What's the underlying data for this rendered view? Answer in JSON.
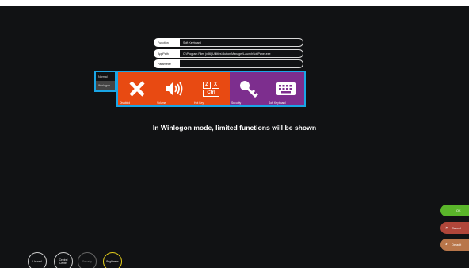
{
  "fields": [
    {
      "label": "Function",
      "value": "Soft Keyboard"
    },
    {
      "label": "AppPath",
      "value": "C:\\Program Files (x86)\\Utilities\\Button Manager\\LaunchSoftPanel.exe"
    },
    {
      "label": "Parameter",
      "value": ""
    }
  ],
  "modes": [
    {
      "label": "Normal"
    },
    {
      "label": "Winlogon"
    }
  ],
  "tiles": [
    {
      "caption": "Disabled",
      "icon": "close-icon",
      "color": "#e84a12"
    },
    {
      "caption": "Volume",
      "icon": "volume-icon",
      "color": "#e84a12"
    },
    {
      "caption": "Hot Key",
      "icon": "hotkey-icon",
      "color": "#e84a12",
      "key1": "Z",
      "key2": "X",
      "key3": "Ctrl"
    },
    {
      "caption": "Security",
      "icon": "key-icon",
      "color": "#7d2e8e"
    },
    {
      "caption": "Soft Keyboard",
      "icon": "keyboard-icon",
      "color": "#7d2e8e"
    }
  ],
  "message": "In Winlogon mode, limited functions will be shown",
  "actions": {
    "ok": {
      "label": "OK",
      "color": "#5ab52a"
    },
    "cancel": {
      "label": "Cancel",
      "color": "#b0463a"
    },
    "default": {
      "label": "Default",
      "color": "#b8764a"
    }
  },
  "bottom": [
    {
      "label": "Unused"
    },
    {
      "label": "Central Center"
    },
    {
      "label": "Security"
    },
    {
      "label": "Brightness"
    }
  ],
  "colors": {
    "highlight": "#1aa6e6",
    "brightness_ring": "#e9d21c"
  }
}
